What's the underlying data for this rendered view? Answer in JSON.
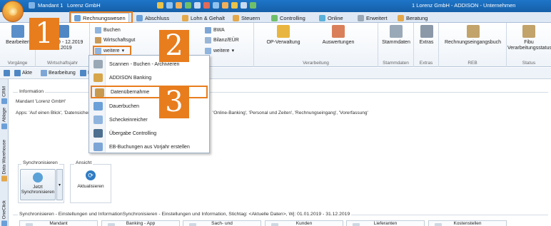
{
  "titlebar": {
    "mandant_label": "Mandant 1",
    "company": "Lorenz GmbH",
    "app_title": "1 Lorenz GmbH - ADDISON - Unternehmen"
  },
  "tabs": [
    {
      "label": "Rechnungswesen"
    },
    {
      "label": "Abschluss"
    },
    {
      "label": "Lohn & Gehalt"
    },
    {
      "label": "Steuern"
    },
    {
      "label": "Controlling"
    },
    {
      "label": "Online"
    },
    {
      "label": "Erweitert"
    },
    {
      "label": "Beratung"
    }
  ],
  "ribbon": {
    "bearbeiten": "Bearbeiten",
    "vorgaenge": "Vorgänge",
    "period_range": "01.2019 - 12.2019",
    "period_single": "01.2019",
    "wirtschaftsjahr": "Wirtschaftsjahr",
    "buchen": "Buchen",
    "wirtschaftsgut": "Wirtschaftsgut",
    "weitere": "weitere",
    "bwa": "BWA",
    "bilanz": "Bilanz/EÜR",
    "weitere2": "weitere",
    "st": "t",
    "op_verwaltung": "OP-Verwaltung",
    "auswertungen": "Auswertungen",
    "verarbeitung": "Verarbeitung",
    "stammdaten": "Stammdaten",
    "stammdaten_group": "Stammdaten",
    "extras": "Extras",
    "extras_group": "Extras",
    "rechnungseingangsbuch": "Rechnungseingangsbuch",
    "reb_group": "REB",
    "fibu_line1": "Fibu",
    "fibu_line2": "Verarbeitungsstatus",
    "status_group": "Status"
  },
  "toolbar2": {
    "akte": "Akte",
    "bearbeitung": "Bearbeitung",
    "p": "P"
  },
  "sidebar_tabs": [
    "CRM",
    "Ablage",
    "Data Warehouse",
    "OneClick"
  ],
  "main": {
    "information": "Information",
    "mandant_line": "Mandant 'Lorenz GmbH'",
    "apps_line_start": "Apps: 'Auf einen Blick', 'Datensicheru",
    "apps_line_end": "'Online-Banking', 'Personal und Zeiten', 'Rechnungseingang', 'Vorerfassung'",
    "synchronisieren_title": "Synchronisieren",
    "ansicht_title": "Ansicht",
    "jetzt_line1": "Jetzt",
    "jetzt_line2": "Synchronisieren",
    "aktualisieren": "Aktualisieren",
    "settings_line": "Synchronisieren - Einstellungen und InformationSynchronisieren - Einstellungen und Information, Stichtag: <Aktuelle Daten>, Wj: 01.01.2019 - 31.12.2019",
    "cards": [
      {
        "line1": "Mandant",
        "line2": ""
      },
      {
        "line1": "Banking - App",
        "line2": ""
      },
      {
        "line1": "Sach- und",
        "line2": ""
      },
      {
        "line1": "Kunden",
        "line2": ""
      },
      {
        "line1": "Lieferanten",
        "line2": ""
      },
      {
        "line1": "Kostenstellen",
        "line2": ""
      }
    ]
  },
  "dropdown": {
    "items": [
      {
        "label": "Scannen - Buchen - Archivieren"
      },
      {
        "label": "ADDISON Banking"
      },
      {
        "label": "Datenübernahme"
      },
      {
        "label": "Dauerbuchen"
      },
      {
        "label": "Scheckeinreicher"
      },
      {
        "label": "Übergabe Controlling"
      },
      {
        "label": "EB-Buchungen aus Vorjahr erstellen"
      }
    ]
  },
  "callouts": [
    "1",
    "2",
    "3"
  ],
  "colors": {
    "highlight": "#e87d1e",
    "titlebar": "#1e75c8"
  }
}
